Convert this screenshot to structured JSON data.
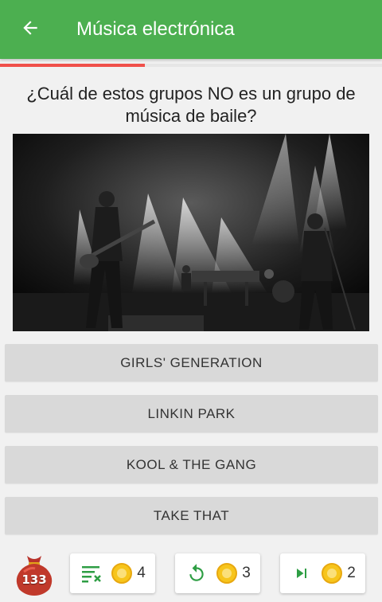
{
  "appbar": {
    "title": "Música electrónica",
    "back_icon": "arrow-left-icon",
    "color": "#4caf50"
  },
  "progress": {
    "fraction": 0.38,
    "color": "#f0504a"
  },
  "question": {
    "text": "¿Cuál de estos grupos NO es un grupo de música de baile?"
  },
  "photo": {
    "description_icon": "concert-photo"
  },
  "answers": [
    {
      "label": "GIRLS' GENERATION"
    },
    {
      "label": "LINKIN PARK"
    },
    {
      "label": "KOOL & THE GANG"
    },
    {
      "label": "TAKE THAT"
    }
  ],
  "footer": {
    "coins_total": "133",
    "powerups": [
      {
        "icon": "remove-answers-icon",
        "cost": "4"
      },
      {
        "icon": "refresh-icon",
        "cost": "3"
      },
      {
        "icon": "skip-icon",
        "cost": "2"
      }
    ]
  }
}
